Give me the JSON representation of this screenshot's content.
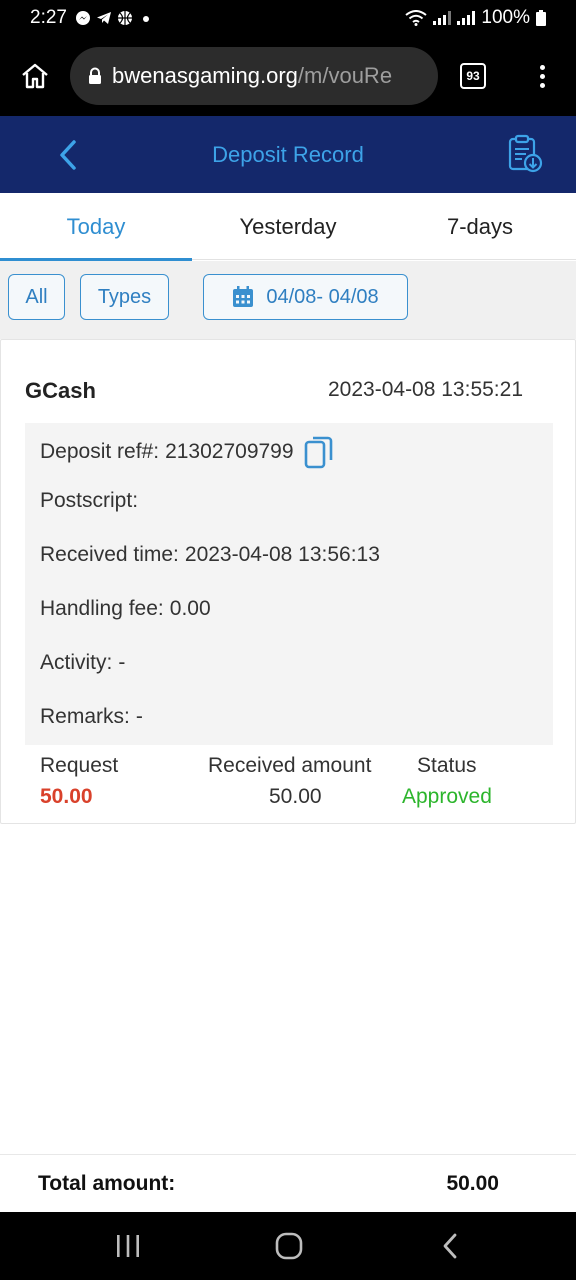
{
  "status_bar": {
    "time": "2:27",
    "battery": "100%"
  },
  "browser": {
    "url_host": "bwenasgaming.org",
    "url_path": "/m/vouRe",
    "tab_count": "93"
  },
  "header": {
    "title": "Deposit Record"
  },
  "date_tabs": [
    {
      "label": "Today",
      "active": true
    },
    {
      "label": "Yesterday",
      "active": false
    },
    {
      "label": "7-days",
      "active": false
    }
  ],
  "filters": {
    "all_label": "All",
    "types_label": "Types",
    "date_range": "04/08- 04/08"
  },
  "record": {
    "method": "GCash",
    "created_at": "2023-04-08 13:55:21",
    "details": [
      {
        "label": "Deposit ref#:",
        "value": "21302709799"
      },
      {
        "label": "Postscript:",
        "value": ""
      },
      {
        "label": "Received time:",
        "value": "2023-04-08 13:56:13"
      },
      {
        "label": "Handling fee:",
        "value": "0.00"
      },
      {
        "label": "Activity:",
        "value": "-"
      },
      {
        "label": "Remarks:",
        "value": "-"
      }
    ],
    "summary": {
      "request_label": "Request",
      "request_value": "50.00",
      "received_label": "Received amount",
      "received_value": "50.00",
      "status_label": "Status",
      "status_value": "Approved"
    }
  },
  "total": {
    "label": "Total amount:",
    "value": "50.00"
  },
  "colors": {
    "header_bg": "#14286b",
    "accent": "#2f8ed1",
    "request_red": "#d9412b",
    "approved_green": "#2cb52c"
  }
}
